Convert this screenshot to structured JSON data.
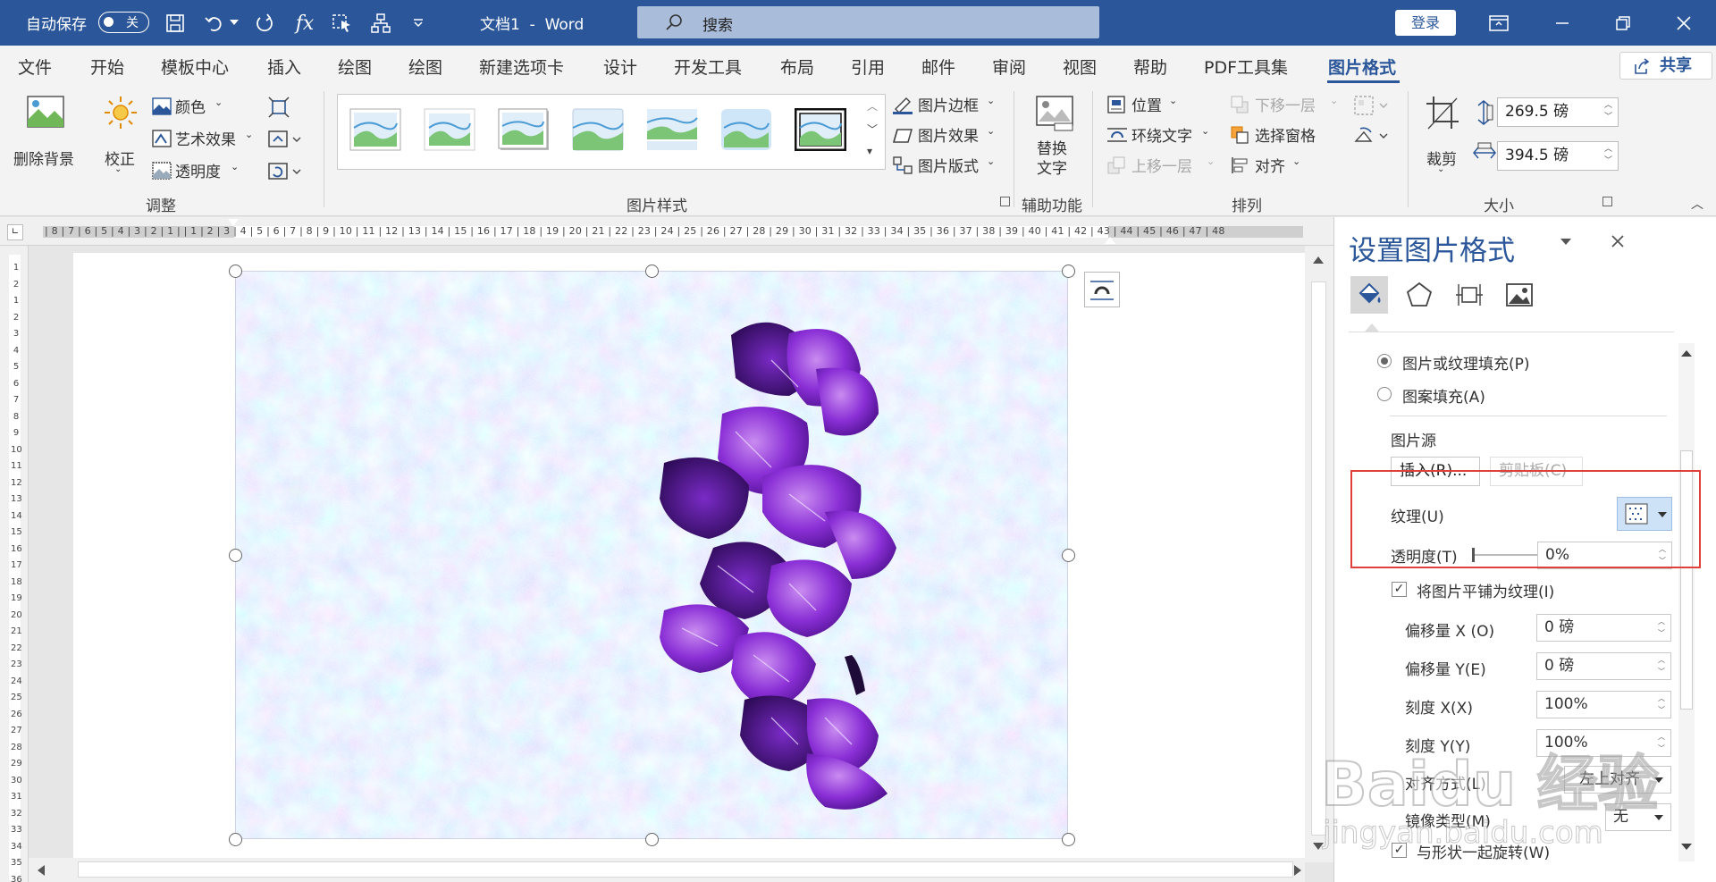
{
  "title_bar": {
    "autosave_label": "自动保存",
    "autosave_state": "关",
    "doc_title": "文档1  -  Word",
    "search_placeholder": "搜索",
    "login_label": "登录"
  },
  "tabs": {
    "items": [
      "文件",
      "开始",
      "模板中心",
      "插入",
      "绘图",
      "绘图",
      "新建选项卡",
      "设计",
      "开发工具",
      "布局",
      "引用",
      "邮件",
      "审阅",
      "视图",
      "帮助",
      "PDF工具集",
      "图片格式"
    ],
    "active": "图片格式",
    "share_label": "共享"
  },
  "ribbon": {
    "remove_bg": "删除背景",
    "correct": "校正",
    "color": "颜色",
    "art_effect": "艺术效果",
    "transparency": "透明度",
    "group_adjust": "调整",
    "group_styles": "图片样式",
    "pic_border": "图片边框",
    "pic_effect": "图片效果",
    "pic_layout": "图片版式",
    "alt_text_1": "替换",
    "alt_text_2": "文字",
    "group_access": "辅助功能",
    "position": "位置",
    "wrap_text": "环绕文字",
    "bring_forward": "上移一层",
    "send_backward": "下移一层",
    "selection_pane": "选择窗格",
    "align": "对齐",
    "group_arrange": "排列",
    "crop": "裁剪",
    "height": "269.5 磅",
    "width": "394.5 磅",
    "group_size": "大小"
  },
  "ruler": {
    "h_labels": "| 8 | 7 | 6 | 5 | 4 | 3 | 2 | 1 |   | 1 | 2 | 3 | 4 | 5 | 6 | 7 | 8 | 9 | 10 | 11 | 12 | 13 | 14 | 15 | 16 | 17 | 18 | 19 | 20 | 21 | 22 | 23 | 24 | 25 | 26 | 27 | 28 | 29 | 30 | 31 | 32 | 33 | 34 | 35 | 36 | 37 | 38 | 39 | 40 | 41 | 42 | 43 | 44 | 45 | 46 | 47 | 48"
  },
  "pane": {
    "title": "设置图片格式",
    "fill_picture": "图片或纹理填充(P)",
    "fill_pattern": "图案填充(A)",
    "picture_source": "图片源",
    "insert_btn": "插入(R)...",
    "clipboard_btn": "剪贴板(C)",
    "texture_label": "纹理(U)",
    "transparency_label": "透明度(T)",
    "transparency_value": "0%",
    "transparency_level": 0,
    "tile_label": "将图片平铺为纹理(I)",
    "offset_x_label": "偏移量 X (O)",
    "offset_x": "0 磅",
    "offset_y_label": "偏移量 Y(E)",
    "offset_y": "0 磅",
    "scale_x_label": "刻度 X(X)",
    "scale_x": "100%",
    "scale_y_label": "刻度 Y(Y)",
    "scale_y": "100%",
    "align_label": "对齐方式(L)",
    "align_value": "左上对齐",
    "mirror_label": "镜像类型(M)",
    "mirror_value": "无",
    "rotate_label": "与形状一起旋转(W)"
  },
  "watermark": {
    "logo": "Baidu 经验",
    "url": "jingyan.baidu.com"
  },
  "colors": {
    "accent": "#2b579a",
    "highlight_box": "#e0403a"
  }
}
